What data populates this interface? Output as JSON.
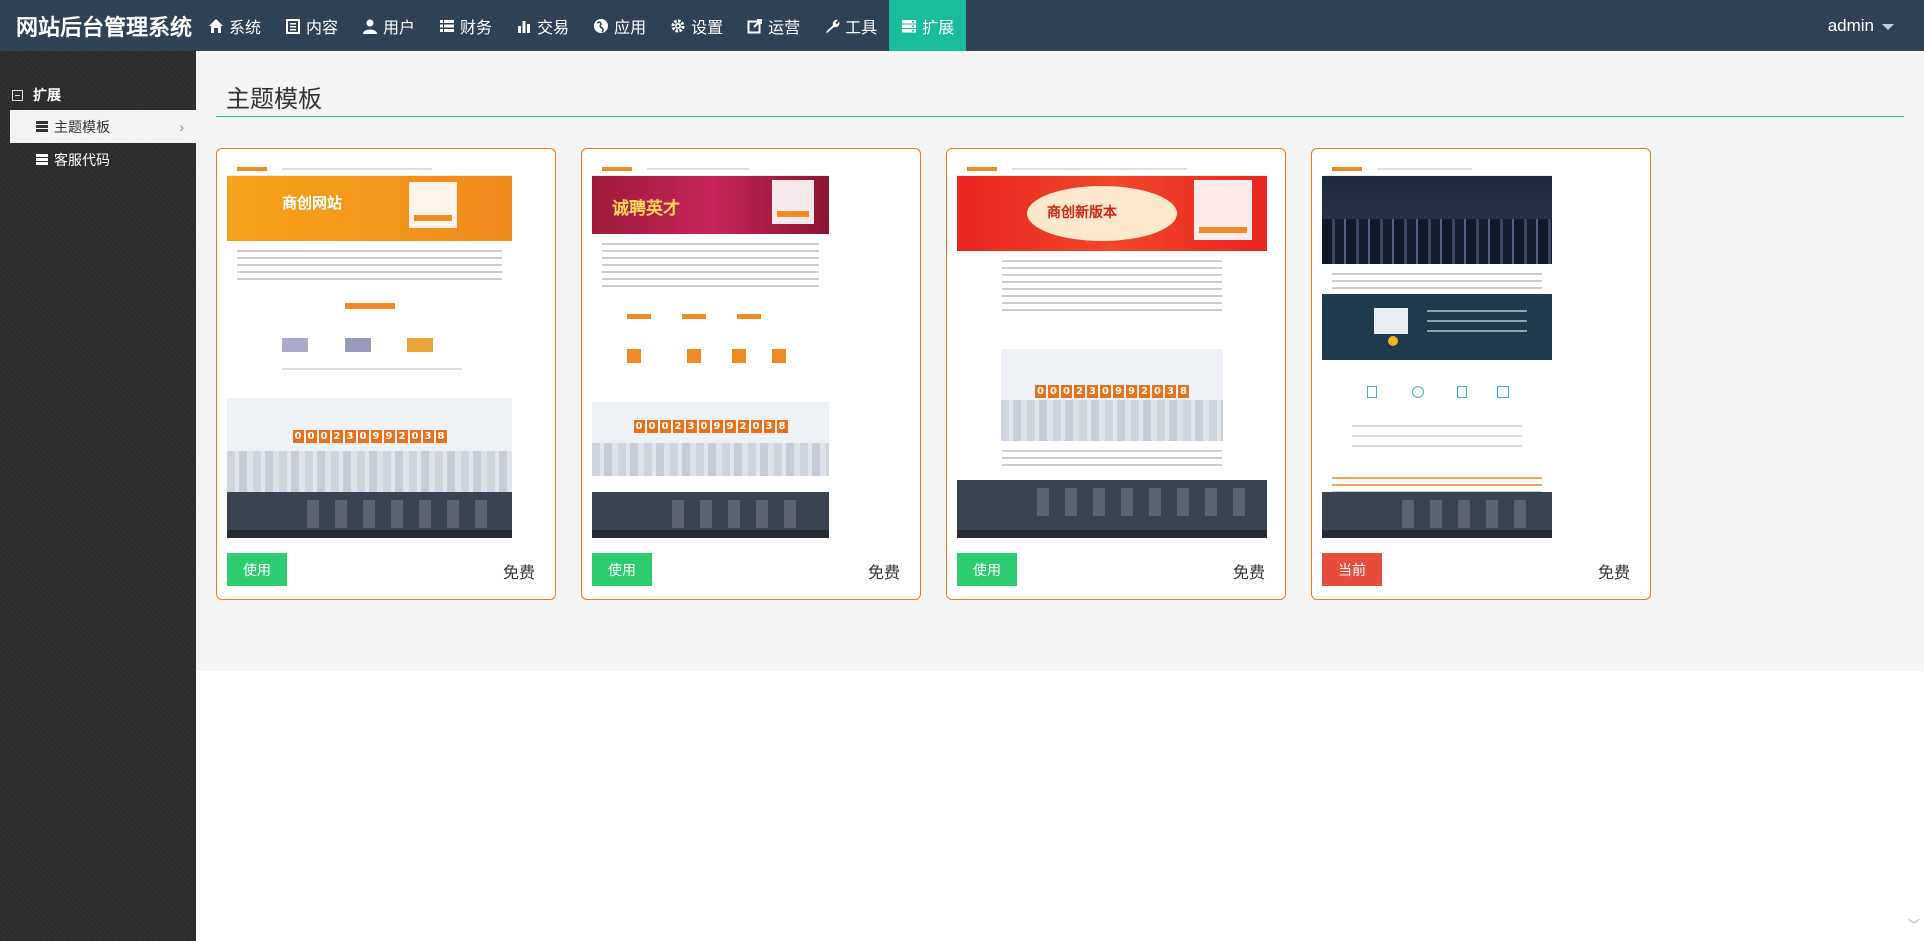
{
  "app": {
    "title": "网站后台管理系统",
    "user": "admin"
  },
  "nav": [
    {
      "icon": "home-icon",
      "label": "系统"
    },
    {
      "icon": "file-icon",
      "label": "内容"
    },
    {
      "icon": "user-icon",
      "label": "用户"
    },
    {
      "icon": "list-icon",
      "label": "财务"
    },
    {
      "icon": "bar-chart-icon",
      "label": "交易"
    },
    {
      "icon": "globe-icon",
      "label": "应用"
    },
    {
      "icon": "gear-icon",
      "label": "设置"
    },
    {
      "icon": "share-icon",
      "label": "运营"
    },
    {
      "icon": "wrench-icon",
      "label": "工具"
    },
    {
      "icon": "server-icon",
      "label": "扩展",
      "active": true
    }
  ],
  "sidebar": {
    "group": "扩展",
    "items": [
      {
        "label": "主题模板",
        "active": true
      },
      {
        "label": "客服代码",
        "active": false
      }
    ]
  },
  "page": {
    "title": "主题模板"
  },
  "themes": [
    {
      "button": "使用",
      "price": "免费",
      "counter": "000230992038",
      "banner": "商创网站"
    },
    {
      "button": "使用",
      "price": "免费",
      "counter": "000230992038",
      "banner": "诚聘英才"
    },
    {
      "button": "使用",
      "price": "免费",
      "counter": "000230992038",
      "banner": "商创新版本"
    },
    {
      "button": "当前",
      "price": "免费",
      "counter": "",
      "banner": ""
    }
  ],
  "colors": {
    "topbar": "#2f4154",
    "accent": "#1abc9c",
    "card_border": "#ed7a1c",
    "use_button": "#2ecc71",
    "current_button": "#e74c3c"
  }
}
